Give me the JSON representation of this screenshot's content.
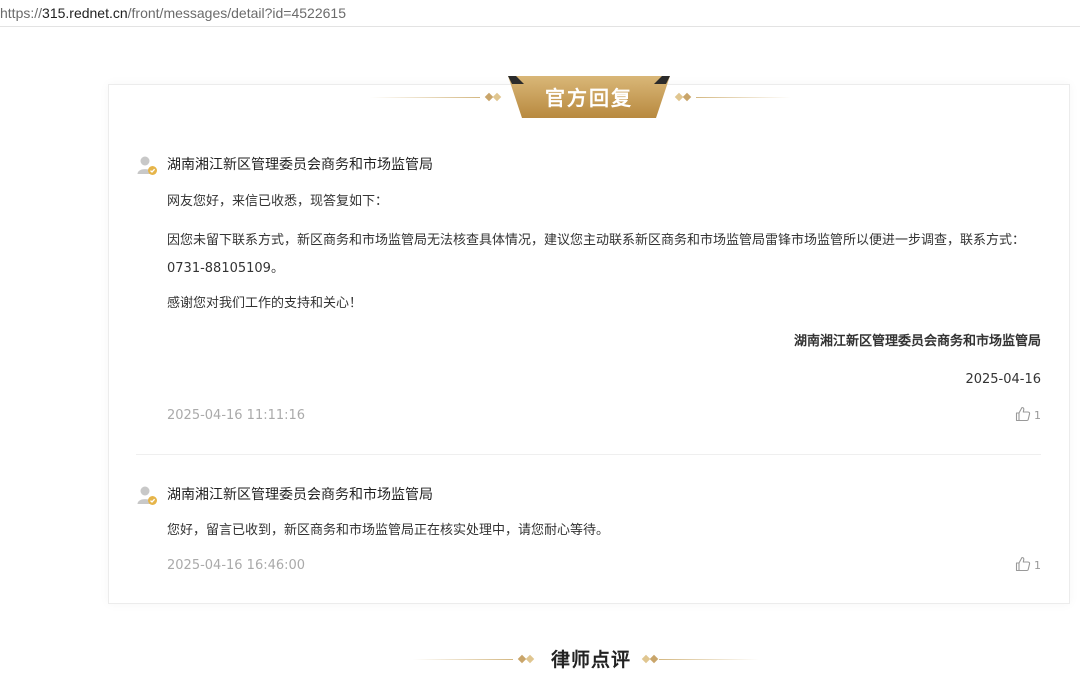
{
  "browser": {
    "url_prefix": "https://",
    "url_host": "315.rednet.cn",
    "url_path": "/front/messages/detail?id=4522615"
  },
  "official_reply": {
    "title": "官方回复",
    "accent_color": "#c9a56a",
    "replies": [
      {
        "author": "湖南湘江新区管理委员会商务和市场监管局",
        "paragraphs": [
          "网友您好，来信已收悉，现答复如下：",
          "因您未留下联系方式，新区商务和市场监管局无法核查具体情况，建议您主动联系新区商务和市场监管局雷锋市场监管所以便进一步调查，联系方式：0731-88105109。",
          "感谢您对我们工作的支持和关心！"
        ],
        "signature": "湖南湘江新区管理委员会商务和市场监管局",
        "signature_date": "2025-04-16",
        "timestamp": "2025-04-16 11:11:16",
        "likes": "1"
      },
      {
        "author": "湖南湘江新区管理委员会商务和市场监管局",
        "paragraphs": [
          "您好，留言已收到，新区商务和市场监管局正在核实处理中，请您耐心等待。"
        ],
        "timestamp": "2025-04-16 16:46:00",
        "likes": "1"
      }
    ]
  },
  "lawyer_review": {
    "title": "律师点评"
  }
}
